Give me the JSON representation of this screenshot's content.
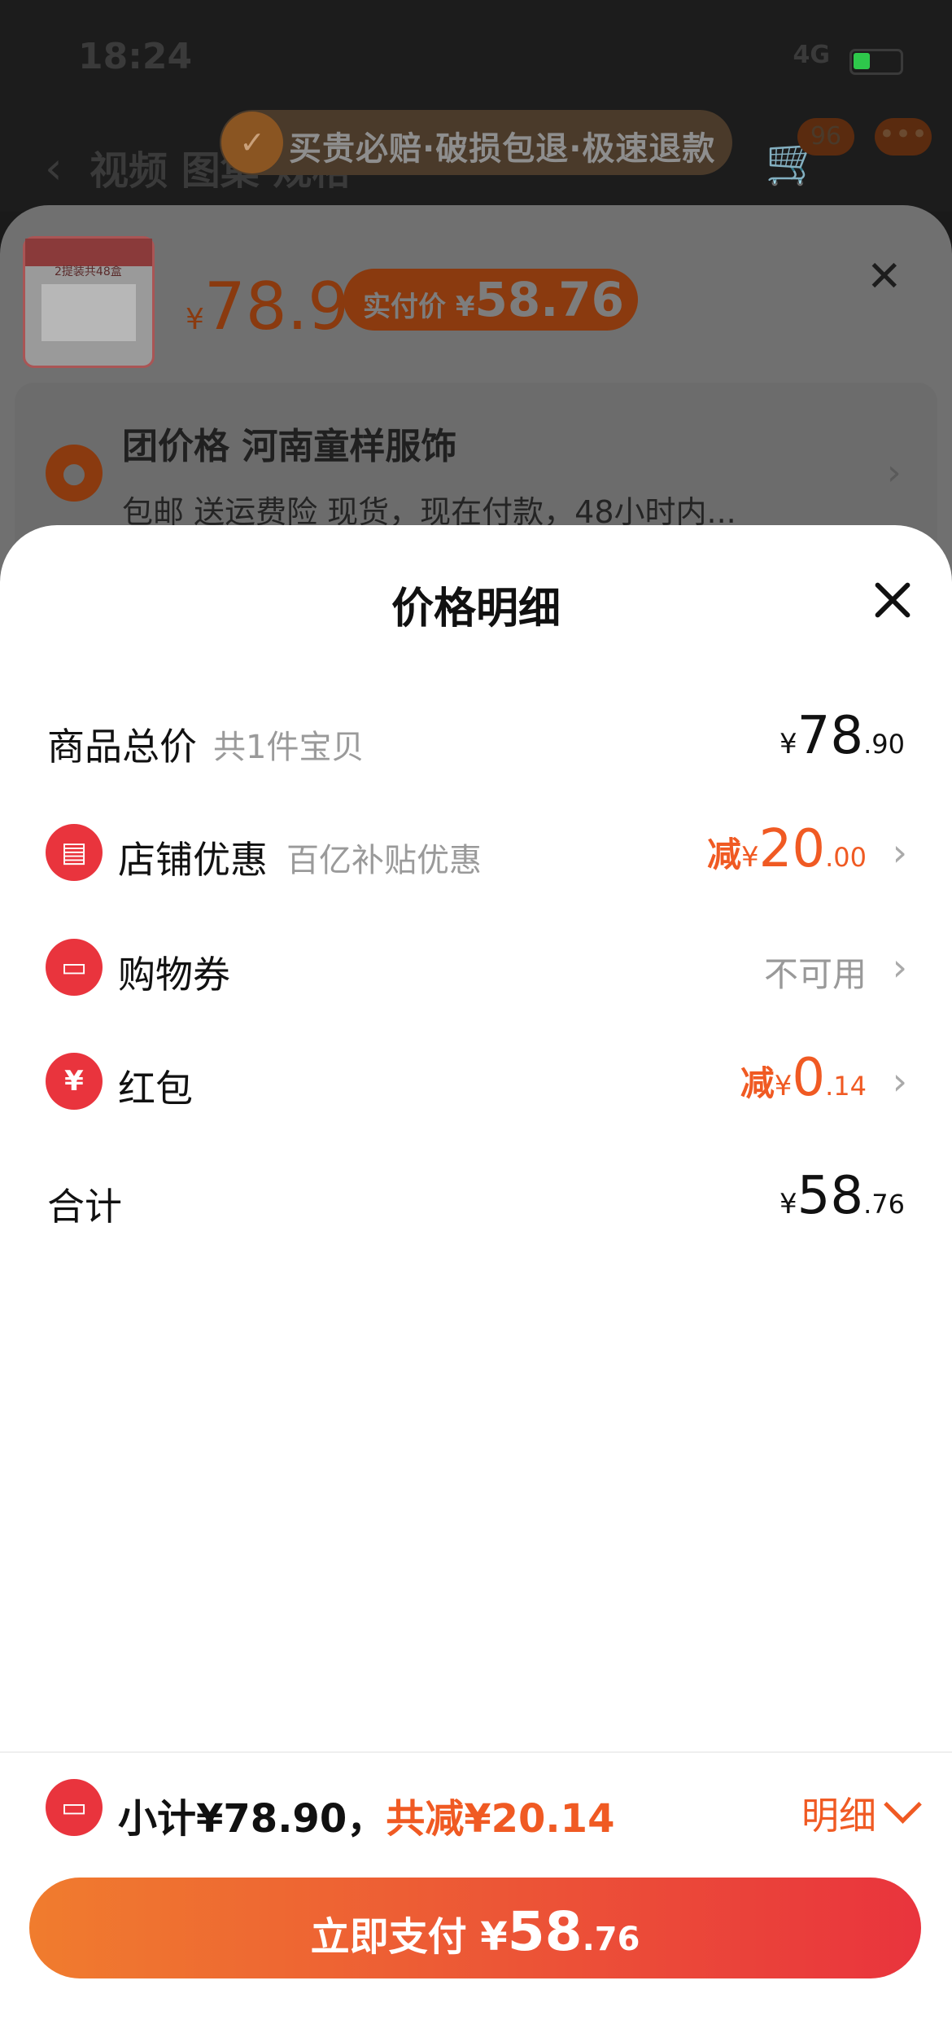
{
  "status_bar": {
    "time": "18:24",
    "network": "4G"
  },
  "product_page": {
    "tabs": "视频  图集  规格",
    "cart_badge": "96",
    "guarantee": "买贵必赔·破损包退·极速退款",
    "product_image_text": "2提装共48盒",
    "price_currency": "¥",
    "price": "78.9",
    "paid_price_label": "实付价 ¥",
    "paid_price": "58.76",
    "address_title": "团价格 河南童样服饰",
    "address_sub": "包邮 送运费险 现货，现在付款，48小时内..."
  },
  "sheet": {
    "title": "价格明细",
    "rows": [
      {
        "label": "商品总价",
        "sub": "共1件宝贝",
        "currency": "¥",
        "int": "78",
        "dec": ".90"
      },
      {
        "label": "店铺优惠",
        "sub": "百亿补贴优惠",
        "prefix": "减",
        "currency": "¥",
        "int": "20",
        "dec": ".00"
      },
      {
        "label": "购物券",
        "value_text": "不可用"
      },
      {
        "label": "红包",
        "prefix": "减",
        "currency": "¥",
        "int": "0",
        "dec": ".14"
      },
      {
        "label": "合计",
        "currency": "¥",
        "int": "58",
        "dec": ".76"
      }
    ]
  },
  "footer": {
    "subtotal": "小计¥78.90，",
    "discount": "共减¥20.14",
    "detail_label": "明细",
    "pay_label": "立即支付 ",
    "pay_currency": "¥",
    "pay_int": "58",
    "pay_dec": ".76"
  },
  "colors": {
    "accent": "#f05a23",
    "brand_red": "#e9343d",
    "gradient_start": "#f07c2e"
  }
}
